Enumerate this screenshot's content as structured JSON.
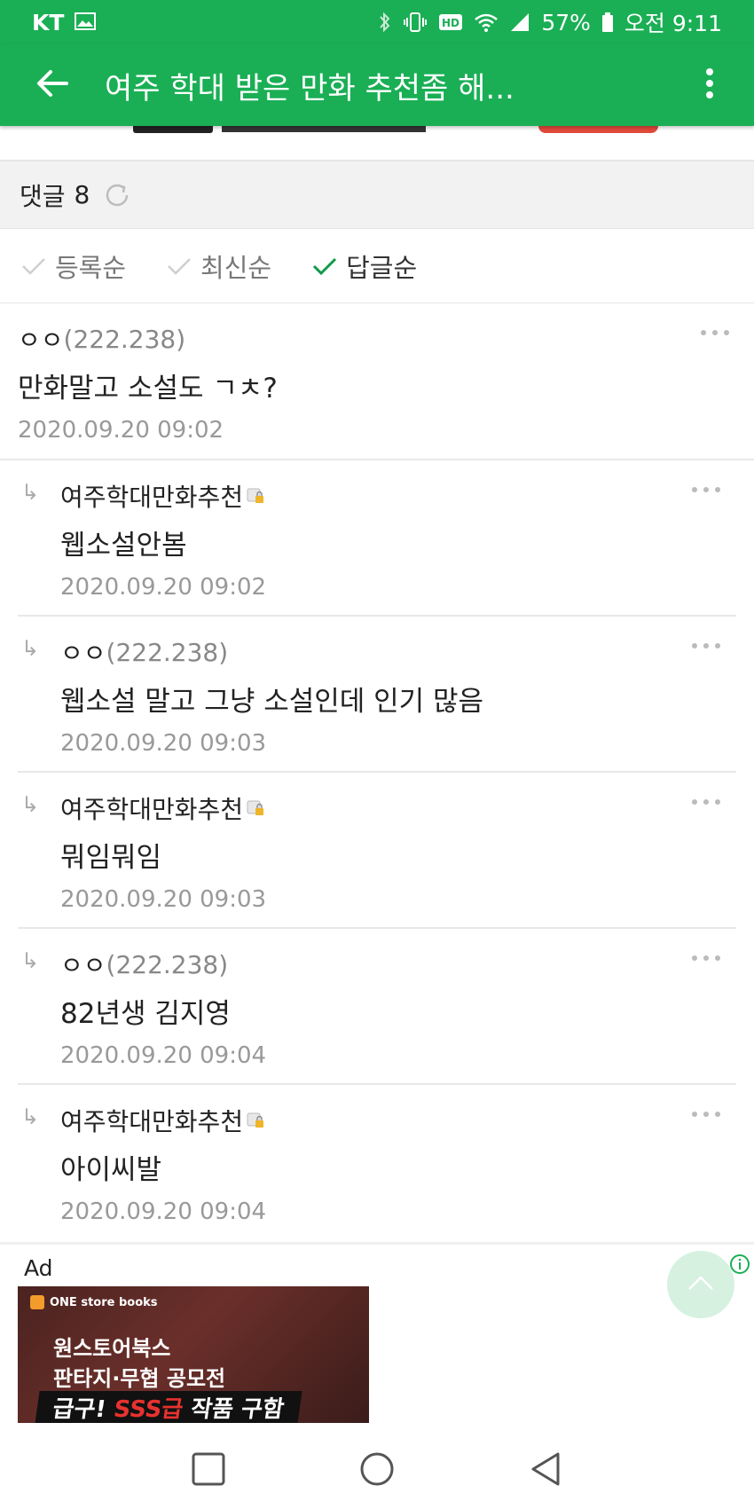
{
  "status_bar": {
    "carrier": "KT",
    "battery": "57%",
    "time": "오전 9:11"
  },
  "app_bar": {
    "title": "여주 학대 받은 만화 추천좀 해..."
  },
  "comment_header": {
    "label": "댓글",
    "count": "8"
  },
  "sort": {
    "options": [
      {
        "label": "등록순",
        "active": false
      },
      {
        "label": "최신순",
        "active": false
      },
      {
        "label": "답글순",
        "active": true
      }
    ]
  },
  "comments": [
    {
      "author": "ㅇㅇ",
      "ip": "(222.238)",
      "body": "만화말고 소설도 ㄱㅊ?",
      "date": "2020.09.20 09:02"
    },
    {
      "author": "여주학대만화추천",
      "ip": "",
      "body": "웹소설안봄",
      "date": "2020.09.20 09:02"
    },
    {
      "author": "ㅇㅇ",
      "ip": "(222.238)",
      "body": "웹소설 말고 그냥 소설인데 인기 많음",
      "date": "2020.09.20 09:03"
    },
    {
      "author": "여주학대만화추천",
      "ip": "",
      "body": "뭐임뭐임",
      "date": "2020.09.20 09:03"
    },
    {
      "author": "ㅇㅇ",
      "ip": "(222.238)",
      "body": "82년생 김지영",
      "date": "2020.09.20 09:04"
    },
    {
      "author": "여주학대만화추천",
      "ip": "",
      "body": "아이씨발",
      "date": "2020.09.20 09:04"
    }
  ],
  "reply_marker": "↳",
  "ad": {
    "label": "Ad",
    "brand": "ONE store books",
    "line1": "원스토어북스",
    "line2": "판타지·무협 공모전",
    "line3_prefix": "급구! ",
    "line3_accent": "SSS급",
    "line3_suffix": " 작품 구함"
  },
  "colors": {
    "brand_green": "#1aaf55",
    "ad_accent": "#e8322f"
  },
  "icons": {
    "back": "arrow-left-icon",
    "more": "vertical-dots-icon",
    "refresh": "refresh-icon",
    "check": "check-icon",
    "lock": "lock-icon",
    "info": "info-icon",
    "scroll_top": "chevron-up-icon",
    "nav_recent": "square-icon",
    "nav_home": "circle-icon",
    "nav_back": "triangle-back-icon"
  }
}
